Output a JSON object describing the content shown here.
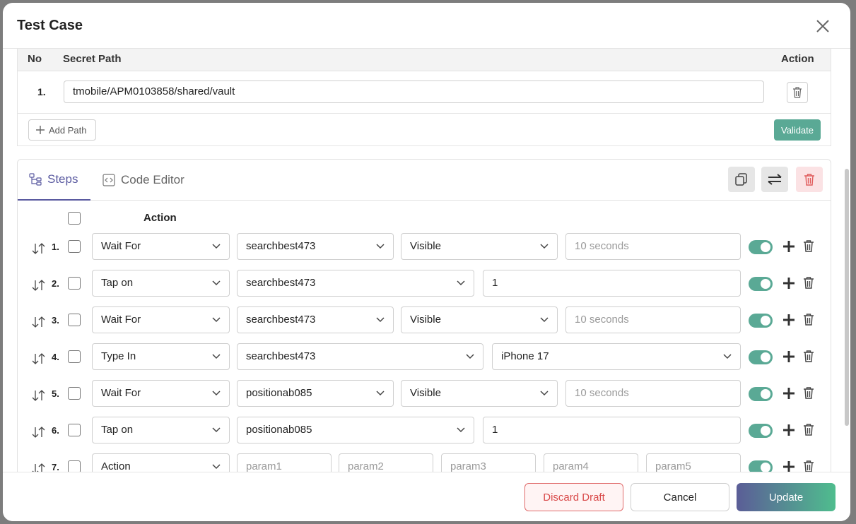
{
  "modal": {
    "title": "Test Case"
  },
  "secrets": {
    "headers": {
      "no": "No",
      "path": "Secret Path",
      "action": "Action"
    },
    "rows": [
      {
        "num": "1.",
        "path": "tmobile/APM0103858/shared/vault"
      }
    ],
    "add_path_label": "Add Path",
    "validate_label": "Validate"
  },
  "tabs": [
    {
      "label": "Steps",
      "active": true
    },
    {
      "label": "Code Editor",
      "active": false
    }
  ],
  "steps": {
    "action_header": "Action",
    "rows": [
      {
        "num": "1.",
        "fields": [
          "Wait For",
          "searchbest473",
          "Visible",
          "10 seconds"
        ]
      },
      {
        "num": "2.",
        "fields": [
          "Tap on",
          "searchbest473",
          "1"
        ]
      },
      {
        "num": "3.",
        "fields": [
          "Wait For",
          "searchbest473",
          "Visible",
          "10 seconds"
        ]
      },
      {
        "num": "4.",
        "fields": [
          "Type In",
          "searchbest473",
          "iPhone 17"
        ]
      },
      {
        "num": "5.",
        "fields": [
          "Wait For",
          "positionab085",
          "Visible",
          "10 seconds"
        ]
      },
      {
        "num": "6.",
        "fields": [
          "Tap on",
          "positionab085",
          "1"
        ]
      },
      {
        "num": "7.",
        "fields": [
          "Action",
          "param1",
          "param2",
          "param3",
          "param4",
          "param5"
        ]
      }
    ]
  },
  "footer": {
    "discard_label": "Discard Draft",
    "cancel_label": "Cancel",
    "update_label": "Update"
  },
  "colors": {
    "accent": "#5aa995",
    "tab_active": "#5a5aa0",
    "danger": "#d94a4a"
  }
}
